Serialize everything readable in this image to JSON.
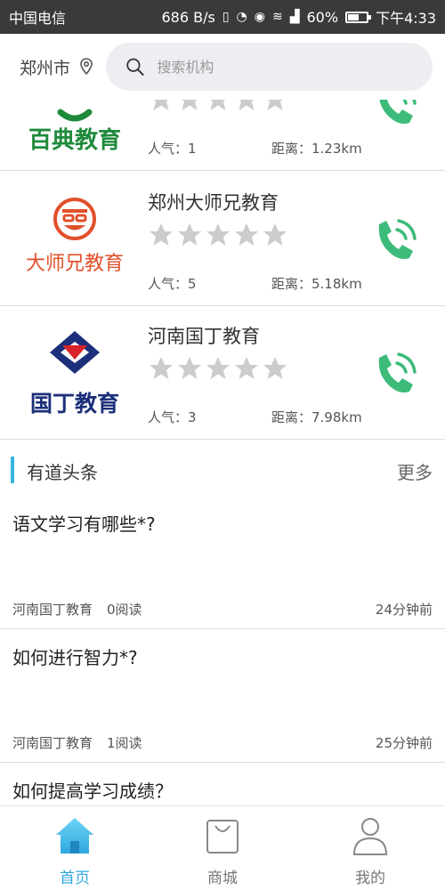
{
  "status_bar": {
    "carrier": "中国电信",
    "speed": "686 B/s",
    "battery": "60%",
    "battery_level": 0.6,
    "time": "下午4:33"
  },
  "header": {
    "city": "郑州市",
    "search_placeholder": "搜索机构"
  },
  "orgs": [
    {
      "name": "",
      "logo_text": "百典教育",
      "popularity": "人气：1",
      "distance": "距离：1.23km",
      "rating": 0
    },
    {
      "name": "郑州大师兄教育",
      "logo_text": "大师兄教育",
      "popularity": "人气：5",
      "distance": "距离：5.18km",
      "rating": 0
    },
    {
      "name": "河南国丁教育",
      "logo_text": "国丁教育",
      "popularity": "人气：3",
      "distance": "距离：7.98km",
      "rating": 0
    }
  ],
  "headlines": {
    "title": "有道头条",
    "more": "更多",
    "items": [
      {
        "question": "语文学习有哪些*?",
        "source": "河南国丁教育",
        "reads": "0阅读",
        "time": "24分钟前"
      },
      {
        "question": "如何进行智力*?",
        "source": "河南国丁教育",
        "reads": "1阅读",
        "time": "25分钟前"
      },
      {
        "question": "如何提高学习成绩？",
        "source": "",
        "reads": "",
        "time": ""
      }
    ]
  },
  "tabs": [
    {
      "label": "首页",
      "icon": "home-icon",
      "active": true
    },
    {
      "label": "商城",
      "icon": "shopping-bag-icon",
      "active": false
    },
    {
      "label": "我的",
      "icon": "user-icon",
      "active": false
    }
  ],
  "colors": {
    "accent": "#2fa8e0",
    "phone_green": "#3dbb7a",
    "star_gray": "#cccccc",
    "baidian_green": "#1f8a3b",
    "dashixiong_orange": "#e0502a",
    "guoding_navy": "#1c2f7a",
    "guoding_red": "#d8232a"
  }
}
